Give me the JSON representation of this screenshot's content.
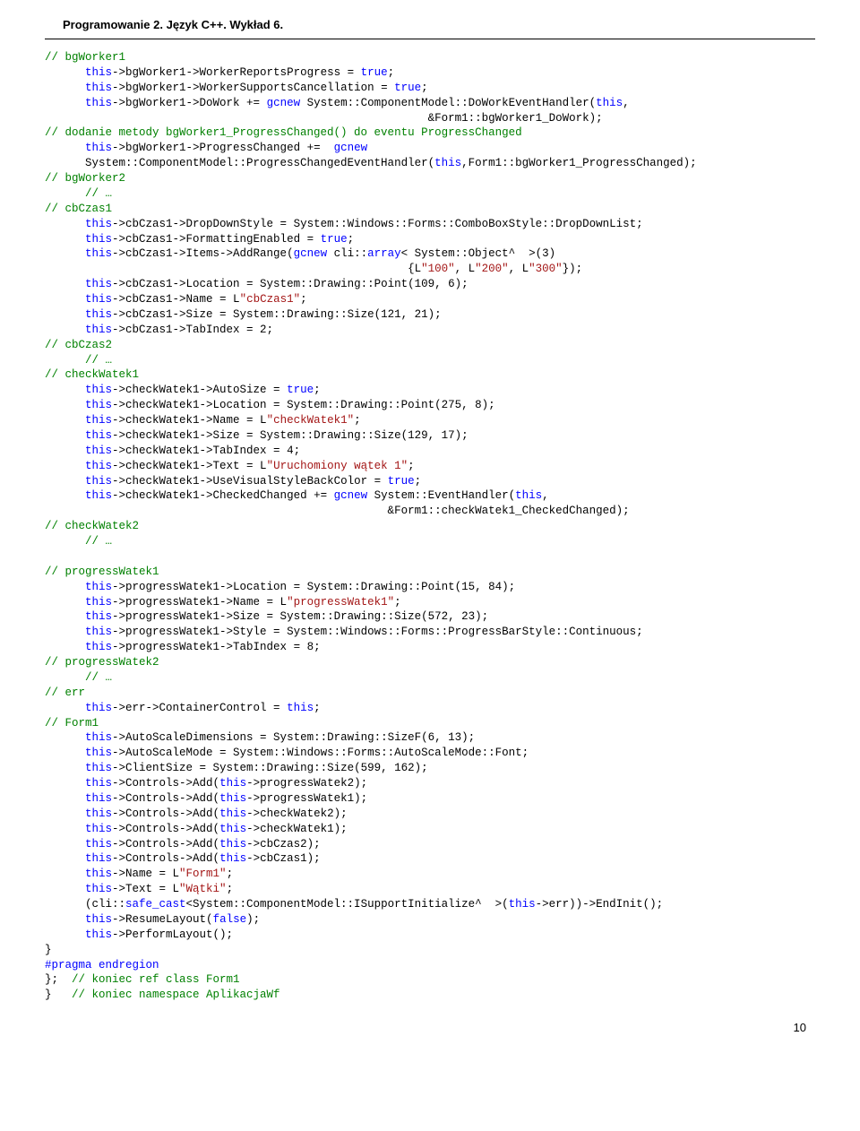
{
  "header": "Programowanie 2. Język C++. Wykład 6.",
  "page_number": "10",
  "code": {
    "l01": "// bgWorker1",
    "l02a": "      ",
    "l02b": "this",
    "l02c": "->bgWorker1->WorkerReportsProgress = ",
    "l02d": "true",
    "l02e": ";",
    "l03a": "      ",
    "l03b": "this",
    "l03c": "->bgWorker1->WorkerSupportsCancellation = ",
    "l03d": "true",
    "l03e": ";",
    "l04a": "      ",
    "l04b": "this",
    "l04c": "->bgWorker1->DoWork += ",
    "l04d": "gcnew",
    "l04e": " System::ComponentModel::DoWorkEventHandler(",
    "l04f": "this",
    "l04g": ",",
    "l05": "                                                         &Form1::bgWorker1_DoWork);",
    "l06": "// dodanie metody bgWorker1_ProgressChanged() do eventu ProgressChanged",
    "l07a": "      ",
    "l07b": "this",
    "l07c": "->bgWorker1->ProgressChanged +=  ",
    "l07d": "gcnew",
    "l08a": "      System::ComponentModel::ProgressChangedEventHandler(",
    "l08b": "this",
    "l08c": ",Form1::bgWorker1_ProgressChanged);",
    "l09": "// bgWorker2",
    "l10": "      // …",
    "l11": "// cbCzas1",
    "l12a": "      ",
    "l12b": "this",
    "l12c": "->cbCzas1->DropDownStyle = System::Windows::Forms::ComboBoxStyle::DropDownList;",
    "l13a": "      ",
    "l13b": "this",
    "l13c": "->cbCzas1->FormattingEnabled = ",
    "l13d": "true",
    "l13e": ";",
    "l14a": "      ",
    "l14b": "this",
    "l14c": "->cbCzas1->Items->AddRange(",
    "l14d": "gcnew",
    "l14e": " cli::",
    "l14f": "array",
    "l14g": "< System::Object^  >(3)",
    "l15a": "                                                      {L",
    "l15b": "\"100\"",
    "l15c": ", L",
    "l15d": "\"200\"",
    "l15e": ", L",
    "l15f": "\"300\"",
    "l15g": "});",
    "l16a": "      ",
    "l16b": "this",
    "l16c": "->cbCzas1->Location = System::Drawing::Point(109, 6);",
    "l17a": "      ",
    "l17b": "this",
    "l17c": "->cbCzas1->Name = L",
    "l17d": "\"cbCzas1\"",
    "l17e": ";",
    "l18a": "      ",
    "l18b": "this",
    "l18c": "->cbCzas1->Size = System::Drawing::Size(121, 21);",
    "l19a": "      ",
    "l19b": "this",
    "l19c": "->cbCzas1->TabIndex = 2;",
    "l20": "// cbCzas2",
    "l21": "      // …",
    "l22": "// checkWatek1",
    "l23a": "      ",
    "l23b": "this",
    "l23c": "->checkWatek1->AutoSize = ",
    "l23d": "true",
    "l23e": ";",
    "l24a": "      ",
    "l24b": "this",
    "l24c": "->checkWatek1->Location = System::Drawing::Point(275, 8);",
    "l25a": "      ",
    "l25b": "this",
    "l25c": "->checkWatek1->Name = L",
    "l25d": "\"checkWatek1\"",
    "l25e": ";",
    "l26a": "      ",
    "l26b": "this",
    "l26c": "->checkWatek1->Size = System::Drawing::Size(129, 17);",
    "l27a": "      ",
    "l27b": "this",
    "l27c": "->checkWatek1->TabIndex = 4;",
    "l28a": "      ",
    "l28b": "this",
    "l28c": "->checkWatek1->Text = L",
    "l28d": "\"Uruchomiony wątek 1\"",
    "l28e": ";",
    "l29a": "      ",
    "l29b": "this",
    "l29c": "->checkWatek1->UseVisualStyleBackColor = ",
    "l29d": "true",
    "l29e": ";",
    "l30a": "      ",
    "l30b": "this",
    "l30c": "->checkWatek1->CheckedChanged += ",
    "l30d": "gcnew",
    "l30e": " System::EventHandler(",
    "l30f": "this",
    "l30g": ",",
    "l31": "                                                   &Form1::checkWatek1_CheckedChanged);",
    "l32": "// checkWatek2",
    "l33": "      // …",
    "blank1": "",
    "l34": "// progressWatek1",
    "l35a": "      ",
    "l35b": "this",
    "l35c": "->progressWatek1->Location = System::Drawing::Point(15, 84);",
    "l36a": "      ",
    "l36b": "this",
    "l36c": "->progressWatek1->Name = L",
    "l36d": "\"progressWatek1\"",
    "l36e": ";",
    "l37a": "      ",
    "l37b": "this",
    "l37c": "->progressWatek1->Size = System::Drawing::Size(572, 23);",
    "l38a": "      ",
    "l38b": "this",
    "l38c": "->progressWatek1->Style = System::Windows::Forms::ProgressBarStyle::Continuous;",
    "l39a": "      ",
    "l39b": "this",
    "l39c": "->progressWatek1->TabIndex = 8;",
    "l40": "// progressWatek2",
    "l41": "      // …",
    "l42": "// err",
    "l43a": "      ",
    "l43b": "this",
    "l43c": "->err->ContainerControl = ",
    "l43d": "this",
    "l43e": ";",
    "l44": "// Form1",
    "l45a": "      ",
    "l45b": "this",
    "l45c": "->AutoScaleDimensions = System::Drawing::SizeF(6, 13);",
    "l46a": "      ",
    "l46b": "this",
    "l46c": "->AutoScaleMode = System::Windows::Forms::AutoScaleMode::Font;",
    "l47a": "      ",
    "l47b": "this",
    "l47c": "->ClientSize = System::Drawing::Size(599, 162);",
    "l48a": "      ",
    "l48b": "this",
    "l48c": "->Controls->Add(",
    "l48d": "this",
    "l48e": "->progressWatek2);",
    "l49a": "      ",
    "l49b": "this",
    "l49c": "->Controls->Add(",
    "l49d": "this",
    "l49e": "->progressWatek1);",
    "l50a": "      ",
    "l50b": "this",
    "l50c": "->Controls->Add(",
    "l50d": "this",
    "l50e": "->checkWatek2);",
    "l51a": "      ",
    "l51b": "this",
    "l51c": "->Controls->Add(",
    "l51d": "this",
    "l51e": "->checkWatek1);",
    "l52a": "      ",
    "l52b": "this",
    "l52c": "->Controls->Add(",
    "l52d": "this",
    "l52e": "->cbCzas2);",
    "l53a": "      ",
    "l53b": "this",
    "l53c": "->Controls->Add(",
    "l53d": "this",
    "l53e": "->cbCzas1);",
    "l54a": "      ",
    "l54b": "this",
    "l54c": "->Name = L",
    "l54d": "\"Form1\"",
    "l54e": ";",
    "l55a": "      ",
    "l55b": "this",
    "l55c": "->Text = L",
    "l55d": "\"Wątki\"",
    "l55e": ";",
    "l56a": "      (cli::",
    "l56b": "safe_cast",
    "l56c": "<System::ComponentModel::ISupportInitialize^  >(",
    "l56d": "this",
    "l56e": "->err))->EndInit();",
    "l57a": "      ",
    "l57b": "this",
    "l57c": "->ResumeLayout(",
    "l57d": "false",
    "l57e": ");",
    "l58a": "      ",
    "l58b": "this",
    "l58c": "->PerformLayout();",
    "l59": "}",
    "l60a": "#pragma",
    "l60b": " ",
    "l60c": "endregion",
    "l61a": "};  ",
    "l61b": "// koniec ref class Form1",
    "l62a": "}   ",
    "l62b": "// koniec namespace AplikacjaWf"
  }
}
